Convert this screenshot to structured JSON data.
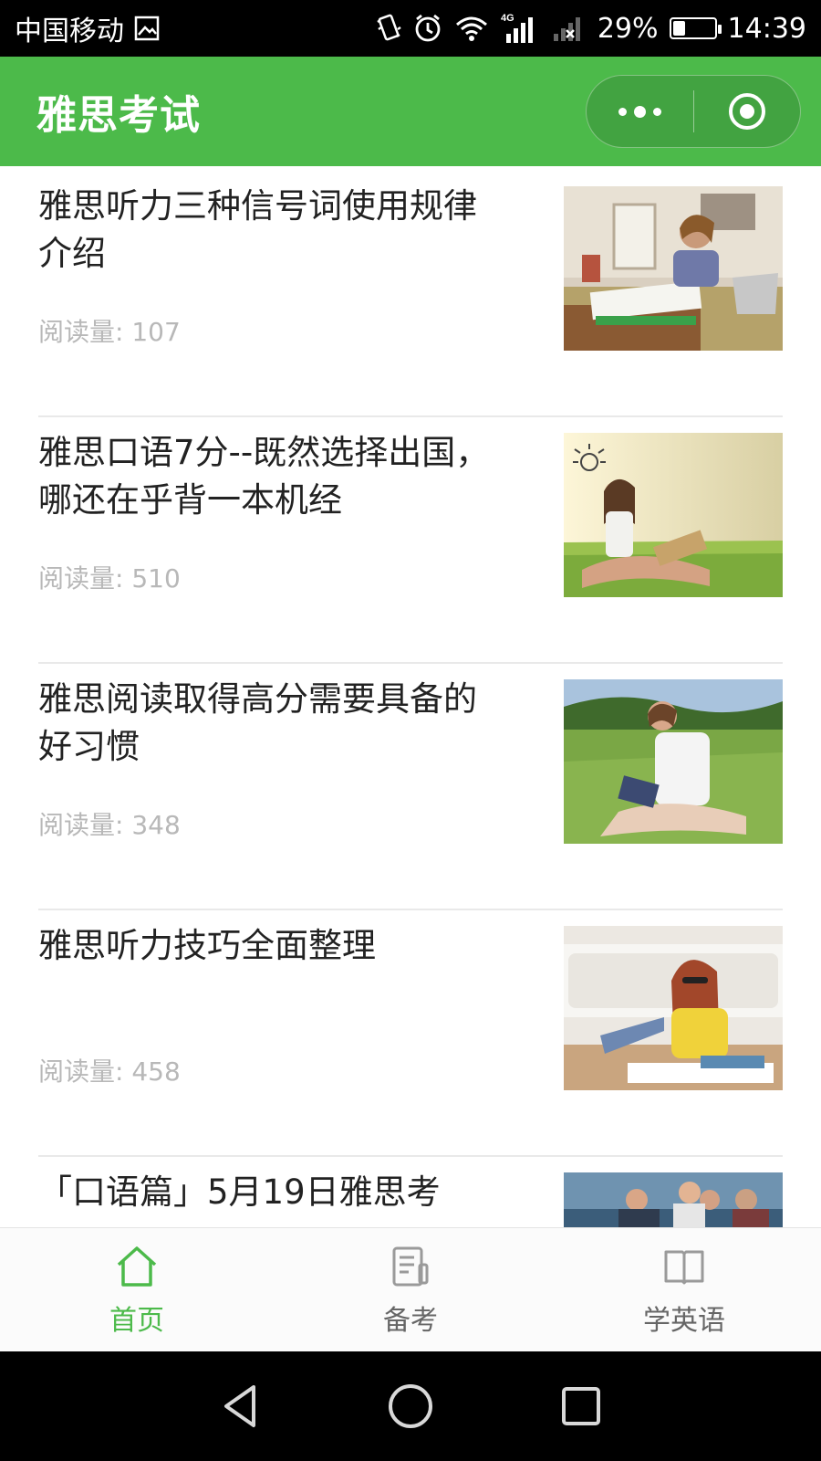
{
  "status_bar": {
    "carrier": "中国移动",
    "network": "4G",
    "battery": "29%",
    "battery_level": 0.29,
    "time": "14:39"
  },
  "header": {
    "title": "雅思考试"
  },
  "articles": [
    {
      "title": "雅思听力三种信号词使用规律介绍",
      "reads": "阅读量: 107"
    },
    {
      "title": "雅思口语7分--既然选择出国，哪还在乎背一本机经",
      "reads": "阅读量: 510"
    },
    {
      "title": "雅思阅读取得高分需要具备的好习惯",
      "reads": "阅读量: 348"
    },
    {
      "title": "雅思听力技巧全面整理",
      "reads": "阅读量: 458"
    },
    {
      "title": "「口语篇」5月19日雅思考",
      "reads": ""
    }
  ],
  "tabbar": {
    "tabs": [
      {
        "label": "首页",
        "icon": "home-icon",
        "active": true
      },
      {
        "label": "备考",
        "icon": "notes-icon",
        "active": false
      },
      {
        "label": "学英语",
        "icon": "book-icon",
        "active": false
      }
    ]
  },
  "colors": {
    "accent": "#4cba4a",
    "text": "#222222",
    "muted": "#b8b8b8"
  }
}
